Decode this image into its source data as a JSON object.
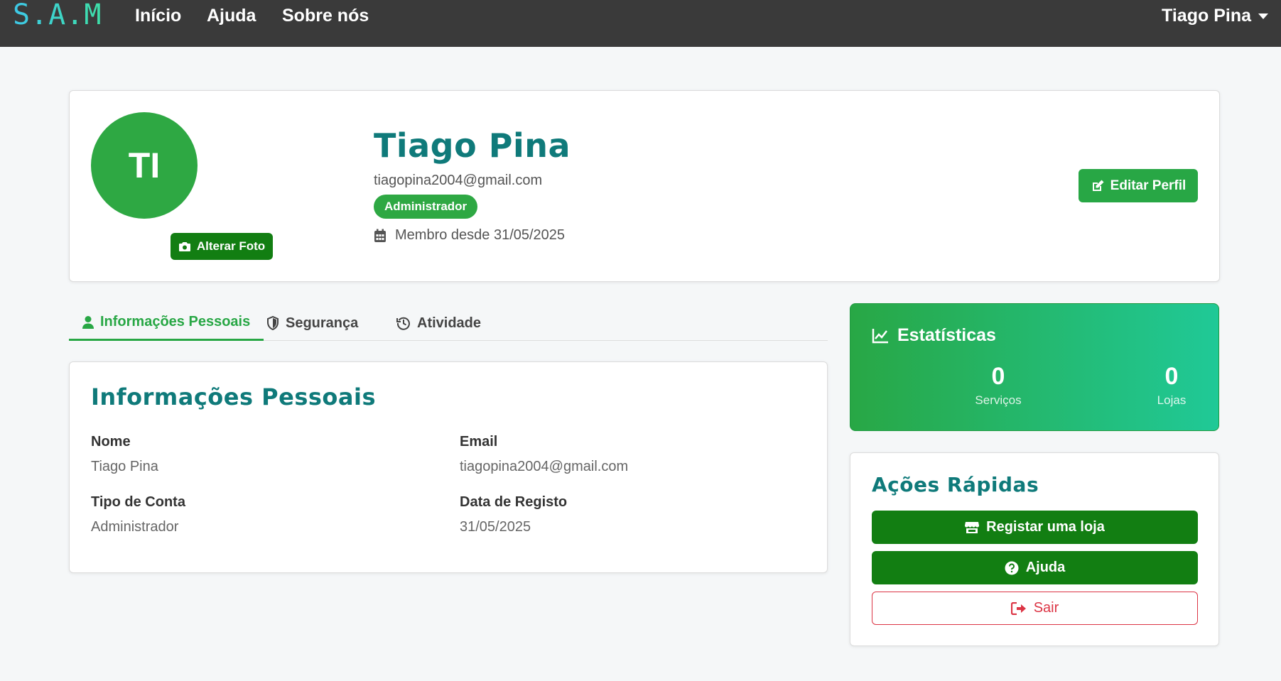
{
  "navbar": {
    "brand": "S.A.M",
    "links": [
      "Início",
      "Ajuda",
      "Sobre nós"
    ],
    "user_name": "Tiago Pina"
  },
  "profile": {
    "initials": "TI",
    "change_photo_label": "Alterar Foto",
    "name": "Tiago Pina",
    "email": "tiagopina2004@gmail.com",
    "role": "Administrador",
    "member_since": "Membro desde 31/05/2025",
    "edit_label": "Editar Perfil"
  },
  "tabs": [
    {
      "label": "Informações Pessoais",
      "active": true
    },
    {
      "label": "Segurança",
      "active": false
    },
    {
      "label": "Atividade",
      "active": false
    }
  ],
  "personal_info": {
    "title": "Informações Pessoais",
    "fields": [
      {
        "label": "Nome",
        "value": "Tiago Pina"
      },
      {
        "label": "Email",
        "value": "tiagopina2004@gmail.com"
      },
      {
        "label": "Tipo de Conta",
        "value": "Administrador"
      },
      {
        "label": "Data de Registo",
        "value": "31/05/2025"
      }
    ]
  },
  "stats": {
    "title": "Estatísticas",
    "items": [
      {
        "value": "0",
        "label": "Serviços"
      },
      {
        "value": "0",
        "label": "Lojas"
      }
    ]
  },
  "quick_actions": {
    "title": "Ações Rápidas",
    "buttons": [
      {
        "label": "Registar uma loja",
        "icon": "store-icon"
      },
      {
        "label": "Ajuda",
        "icon": "question-circle-icon"
      },
      {
        "label": "Sair",
        "icon": "sign-out-icon"
      }
    ]
  },
  "colors": {
    "navbar": "#3a3a3a",
    "primary_green": "#28a745",
    "dark_green": "#127e12",
    "teal_heading": "#0f7a7a",
    "danger": "#dc3545"
  }
}
